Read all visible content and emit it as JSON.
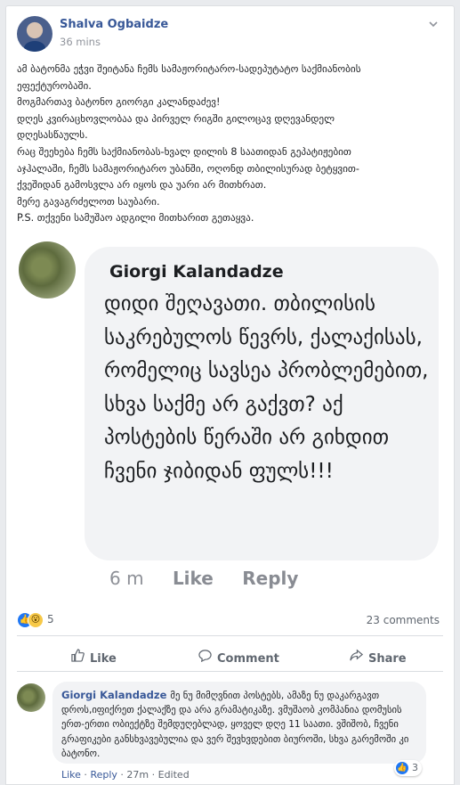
{
  "post": {
    "author": "Shalva Ogbaidze",
    "time": "36 mins",
    "menu_icon": "chevron-down-icon",
    "text_lines": [
      "ამ ბატონმა ეჭვი შეიტანა ჩემს სამაჟორიტარო-სადეპუტატო საქმიანობის",
      "ეფექტურობაში.",
      "მოგმართავ ბატონო გიორგი კალანდაძევ!",
      "დღეს კვირაცხოვლობაა და პირველ რიგში გილოცავ დღევანდელ",
      "დღესასწაულს.",
      "რაც შეეხება ჩემს საქმიანობას-ხვალ დილის 8 საათიდან გეპატიჟებით",
      "აჯჰალაში, ჩემს სამაჟორიტარო უბანში, ოღონდ თბილისურად ბეტყვით-",
      "ქვეშიდან გამოსვლა არ იყოს და უარი არ მითხრათ.",
      "მერე გავაგრძელოთ საუბარი.",
      "P.S. თქვენი სამუშაო ადგილი მითხარით გეთაყვა."
    ]
  },
  "screenshot_comment": {
    "name": "Giorgi Kalandadze",
    "text": "დიდი შეღავათი. თბილისის საკრებულოს წევრს, ქალაქისას, რომელიც სავსეა პრობლემებით, სხვა საქმე არ გაქვთ? აქ პოსტების წერაში არ გიხდით ჩვენი ჯიბიდან ფულს!!!",
    "time": "6 m",
    "like": "Like",
    "reply": "Reply"
  },
  "stats": {
    "reaction_count": "5",
    "comments": "23 comments"
  },
  "actions": {
    "like": "Like",
    "comment": "Comment",
    "share": "Share"
  },
  "comment": {
    "name": "Giorgi Kalandadze",
    "text": "მე ნუ მიმღვნით პოსტებს, ამაზე ნუ დაკარგავთ დროს,იფიქრეთ ქალაქზე და არა გრამატიკაზე. ვმუშაობ კომპანია დომუსის ერთ-ერთი ობიექტზე შემდუღებლად, ყოველ დღე 11 საათი. ვშიშობ, ჩვენი გრაფიკები განსხვავებულია და ვერ შევხვდებით ბიუროში, სხვა გარემოში კი ბატონო.",
    "reaction_count": "3",
    "like": "Like",
    "reply": "Reply",
    "time": "27m",
    "edited": "Edited"
  },
  "colors": {
    "link": "#385898",
    "like_blue": "#2078f4",
    "bubble_bg": "#f2f3f5"
  }
}
